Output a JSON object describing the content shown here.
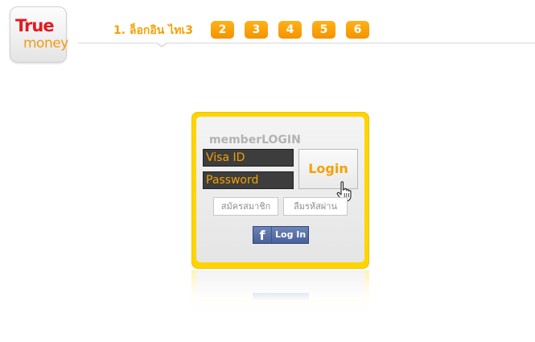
{
  "logo": {
    "line1": "True",
    "line2": "money"
  },
  "steps": {
    "step1_label": "1. ล็อกอิน ไทเ3",
    "badges": [
      "2",
      "3",
      "4",
      "5",
      "6"
    ]
  },
  "login": {
    "title": "memberLOGIN",
    "visa_placeholder": "Visa ID",
    "password_placeholder": "Password",
    "login_label": "Login",
    "register_label": "สมัครสมาชิก",
    "forgot_label": "ลืมรหัสผ่าน",
    "facebook_label": "Log In",
    "facebook_glyph": "f"
  },
  "colors": {
    "brand_red": "#e11b22",
    "accent_orange": "#f5a100",
    "panel_yellow": "#ffd500",
    "facebook_blue": "#4a619b"
  }
}
